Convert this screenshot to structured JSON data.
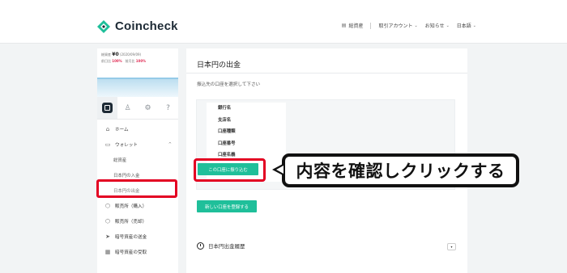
{
  "header": {
    "logo_text": "Coincheck",
    "nav": [
      {
        "icon": "document-icon",
        "label": "総資産"
      },
      {
        "label": "取引アカウント"
      },
      {
        "label": "お知らせ"
      },
      {
        "label": "日本語"
      }
    ]
  },
  "sidebar": {
    "balance": {
      "label": "総資産",
      "value": "¥0",
      "date": "(2020/09/09)",
      "change1_label": "前日比",
      "change1_value": "100%",
      "change2_label": "前月比",
      "change2_value": "100%"
    },
    "menu": [
      {
        "label": "ホーム",
        "icon": "home-icon",
        "sub": false
      },
      {
        "label": "ウォレット",
        "icon": "wallet-icon",
        "sub": false,
        "expand": "^"
      },
      {
        "label": "総資産",
        "sub": true
      },
      {
        "label": "日本円の入金",
        "sub": true
      },
      {
        "label": "日本円の出金",
        "sub": true,
        "current": true
      },
      {
        "label": "販売所（購入）",
        "icon": "cube-icon",
        "sub": false
      },
      {
        "label": "販売所（売却）",
        "icon": "cube-icon",
        "sub": false
      },
      {
        "label": "暗号資産の送金",
        "icon": "send-icon",
        "sub": false
      },
      {
        "label": "暗号資産の受取",
        "icon": "qr-icon",
        "sub": false
      }
    ]
  },
  "main": {
    "title": "日本円の出金",
    "instruction": "振込先の口座を選択して下さい",
    "fields": [
      "銀行名",
      "支店名",
      "口座種類",
      "口座番号",
      "口座名義"
    ],
    "transfer_button": "この口座に振り込む",
    "register_button": "新しい口座を登録する",
    "history_title": "日本円出金履歴",
    "history_toggle": "▾"
  },
  "callout": {
    "text": "内容を確認しクリックする"
  },
  "colors": {
    "accent_green": "#1fbf9a",
    "highlight_red": "#e30022",
    "change_red": "#e02d55"
  }
}
